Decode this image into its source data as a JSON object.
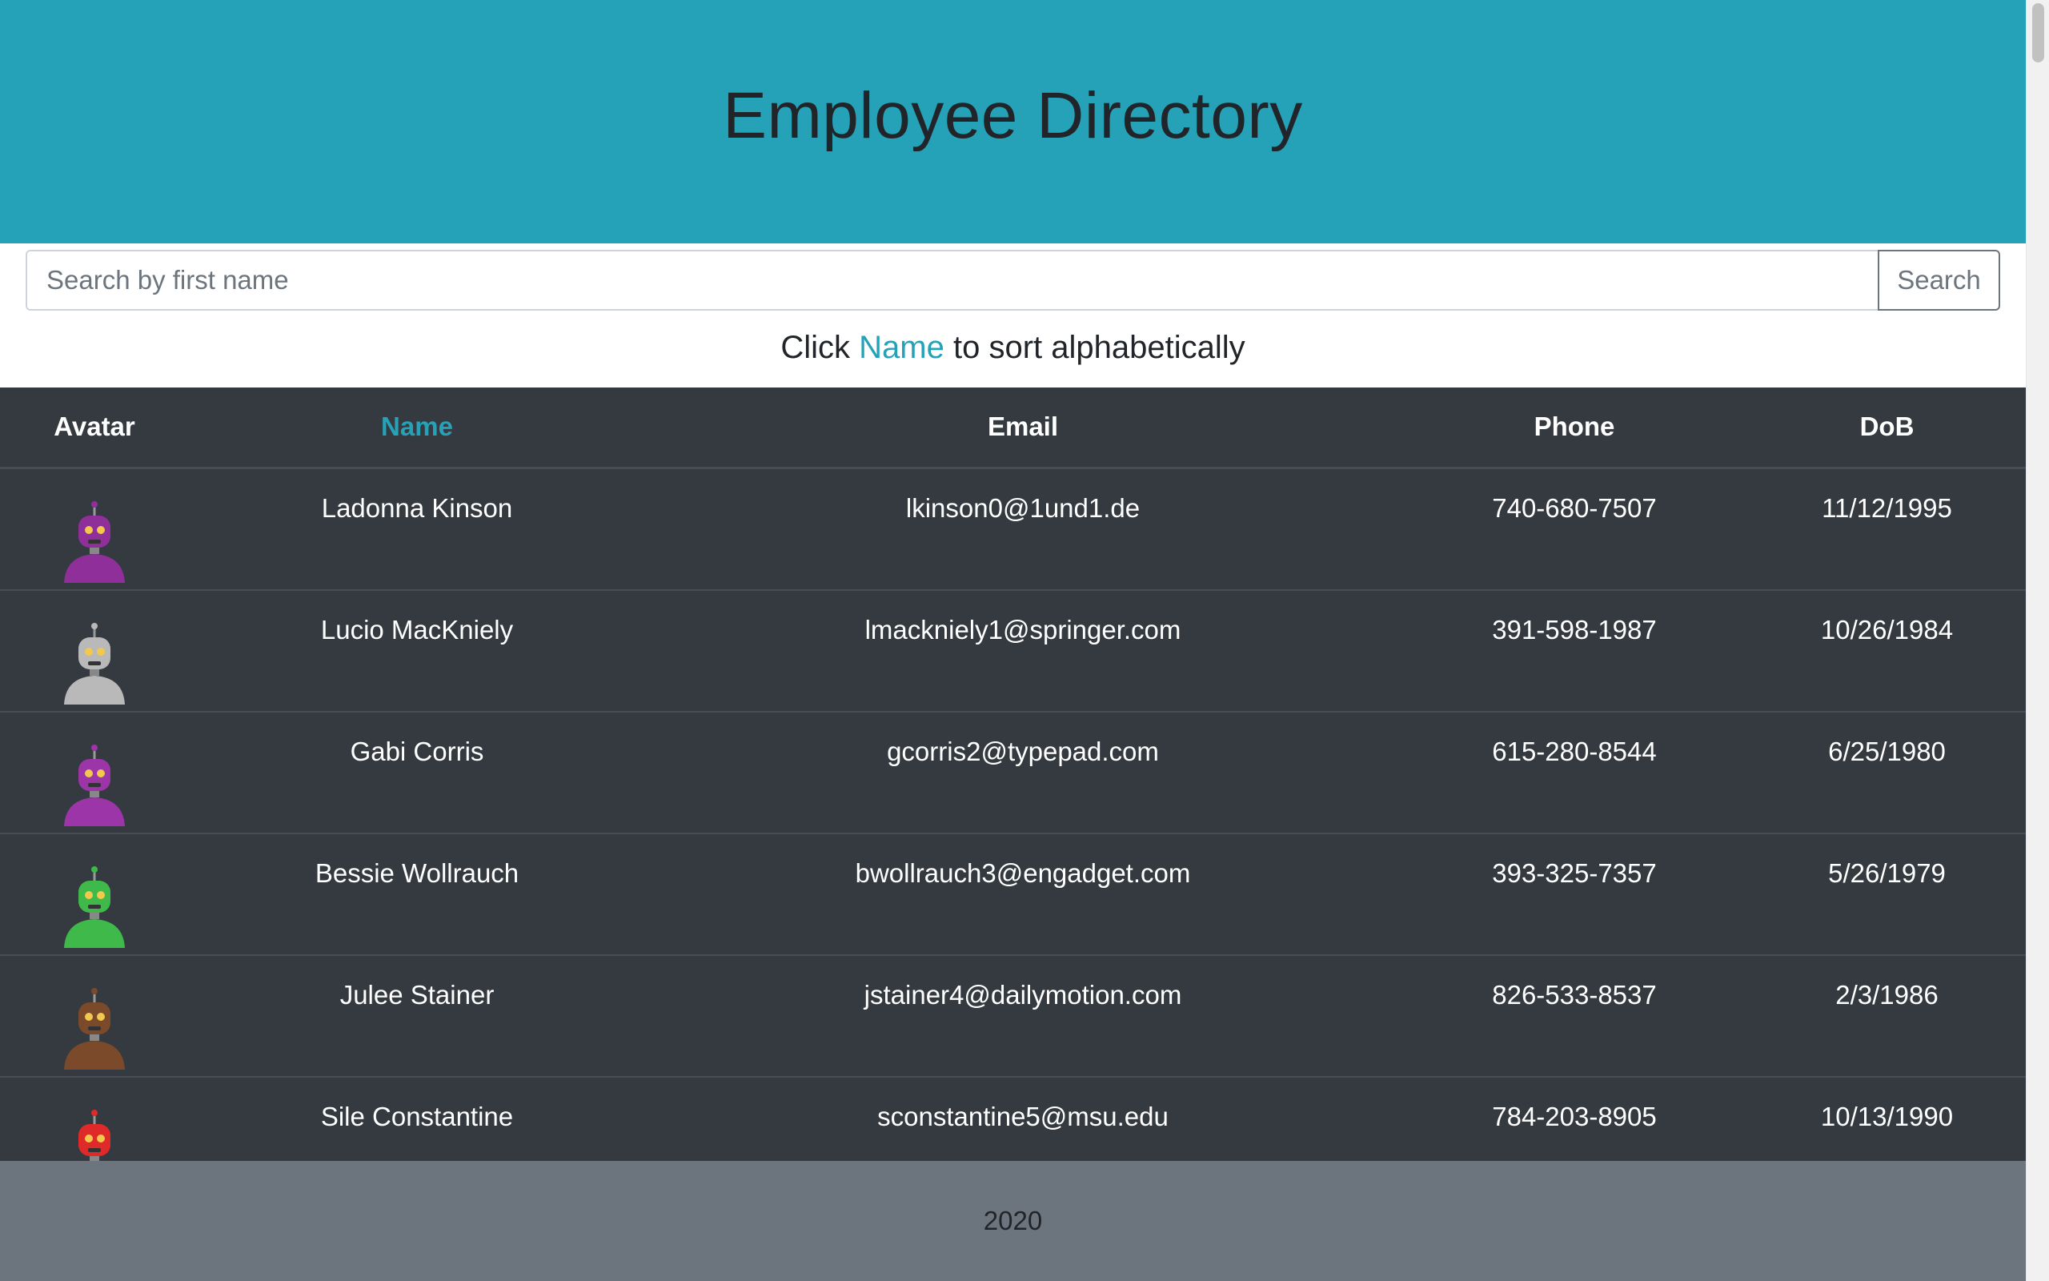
{
  "header": {
    "title": "Employee Directory"
  },
  "search": {
    "placeholder": "Search by first name",
    "value": "",
    "button_label": "Search"
  },
  "hint": {
    "prefix": "Click",
    "link": "Name",
    "suffix": "to sort alphabetically"
  },
  "table": {
    "columns": [
      "Avatar",
      "Name",
      "Email",
      "Phone",
      "DoB"
    ],
    "rows": [
      {
        "avatar_icon": "robot-avatar-purple",
        "avatar_color": "#8e2f9a",
        "name": "Ladonna Kinson",
        "email": "lkinson0@1und1.de",
        "phone": "740-680-7507",
        "dob": "11/12/1995"
      },
      {
        "avatar_icon": "robot-avatar-gray",
        "avatar_color": "#b9b9b9",
        "name": "Lucio MacKniely",
        "email": "lmackniely1@springer.com",
        "phone": "391-598-1987",
        "dob": "10/26/1984"
      },
      {
        "avatar_icon": "robot-avatar-purple",
        "avatar_color": "#9b35a8",
        "name": "Gabi Corris",
        "email": "gcorris2@typepad.com",
        "phone": "615-280-8544",
        "dob": "6/25/1980"
      },
      {
        "avatar_icon": "robot-avatar-green",
        "avatar_color": "#3fb94a",
        "name": "Bessie Wollrauch",
        "email": "bwollrauch3@engadget.com",
        "phone": "393-325-7357",
        "dob": "5/26/1979"
      },
      {
        "avatar_icon": "robot-avatar-brown",
        "avatar_color": "#7a4a2a",
        "name": "Julee Stainer",
        "email": "jstainer4@dailymotion.com",
        "phone": "826-533-8537",
        "dob": "2/3/1986"
      },
      {
        "avatar_icon": "robot-avatar-red",
        "avatar_color": "#e02a2a",
        "name": "Sile Constantine",
        "email": "sconstantine5@msu.edu",
        "phone": "784-203-8905",
        "dob": "10/13/1990"
      }
    ]
  },
  "footer": {
    "text": "2020"
  },
  "colors": {
    "header_bg": "#25a2b8",
    "accent": "#25a2b8",
    "table_bg": "#343a40",
    "footer_bg": "#6c757d"
  }
}
